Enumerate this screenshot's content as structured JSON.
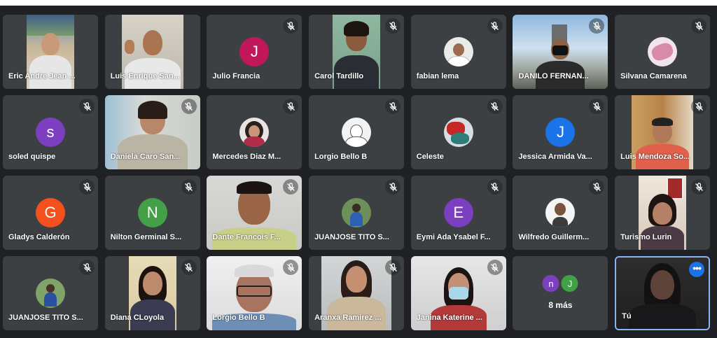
{
  "participants": [
    {
      "name": "Eric Andre Jean ..."
    },
    {
      "name": "Luis Enrique San..."
    },
    {
      "name": "Julio Francia",
      "initial": "J"
    },
    {
      "name": "Carol Tardillo"
    },
    {
      "name": "fabian lema"
    },
    {
      "name": "DANILO FERNAN..."
    },
    {
      "name": "Silvana Camarena"
    },
    {
      "name": "soled quispe",
      "initial": "s"
    },
    {
      "name": "Daniela Caro San..."
    },
    {
      "name": "Mercedes Diaz M..."
    },
    {
      "name": "Lorgio Bello B"
    },
    {
      "name": "Celeste"
    },
    {
      "name": "Jessica Armida Va...",
      "initial": "J"
    },
    {
      "name": "Luis Mendoza So..."
    },
    {
      "name": "Gladys Calderón",
      "initial": "G"
    },
    {
      "name": "Nilton Germinal S...",
      "initial": "N"
    },
    {
      "name": "Dante Francois F..."
    },
    {
      "name": "JUANJOSE TITO S..."
    },
    {
      "name": "Eymi Ada Ysabel F...",
      "initial": "E"
    },
    {
      "name": "Wilfredo Guillerm..."
    },
    {
      "name": "Turismo Lurin"
    },
    {
      "name": "JUANJOSE TITO S..."
    },
    {
      "name": "Diana CLoyola"
    },
    {
      "name": "Lorgio Bello B"
    },
    {
      "name": "Aranxa Ramirez ..."
    },
    {
      "name": "Janina Katerine ..."
    }
  ],
  "overflow": {
    "label": "8 más",
    "initials": [
      "n",
      "J"
    ]
  },
  "self_tile": {
    "name": "Tú",
    "options_icon": "more-horiz-icon"
  },
  "colors": {
    "tile_background": "#3c4043",
    "page_background": "#202124",
    "self_border": "#8ab4f8",
    "options_button": "#1a73e8",
    "avatar_magenta": "#c2185b",
    "avatar_purple": "#7b3fc0",
    "avatar_blue": "#1a73e8",
    "avatar_orange": "#f4511e",
    "avatar_green": "#43a047"
  }
}
